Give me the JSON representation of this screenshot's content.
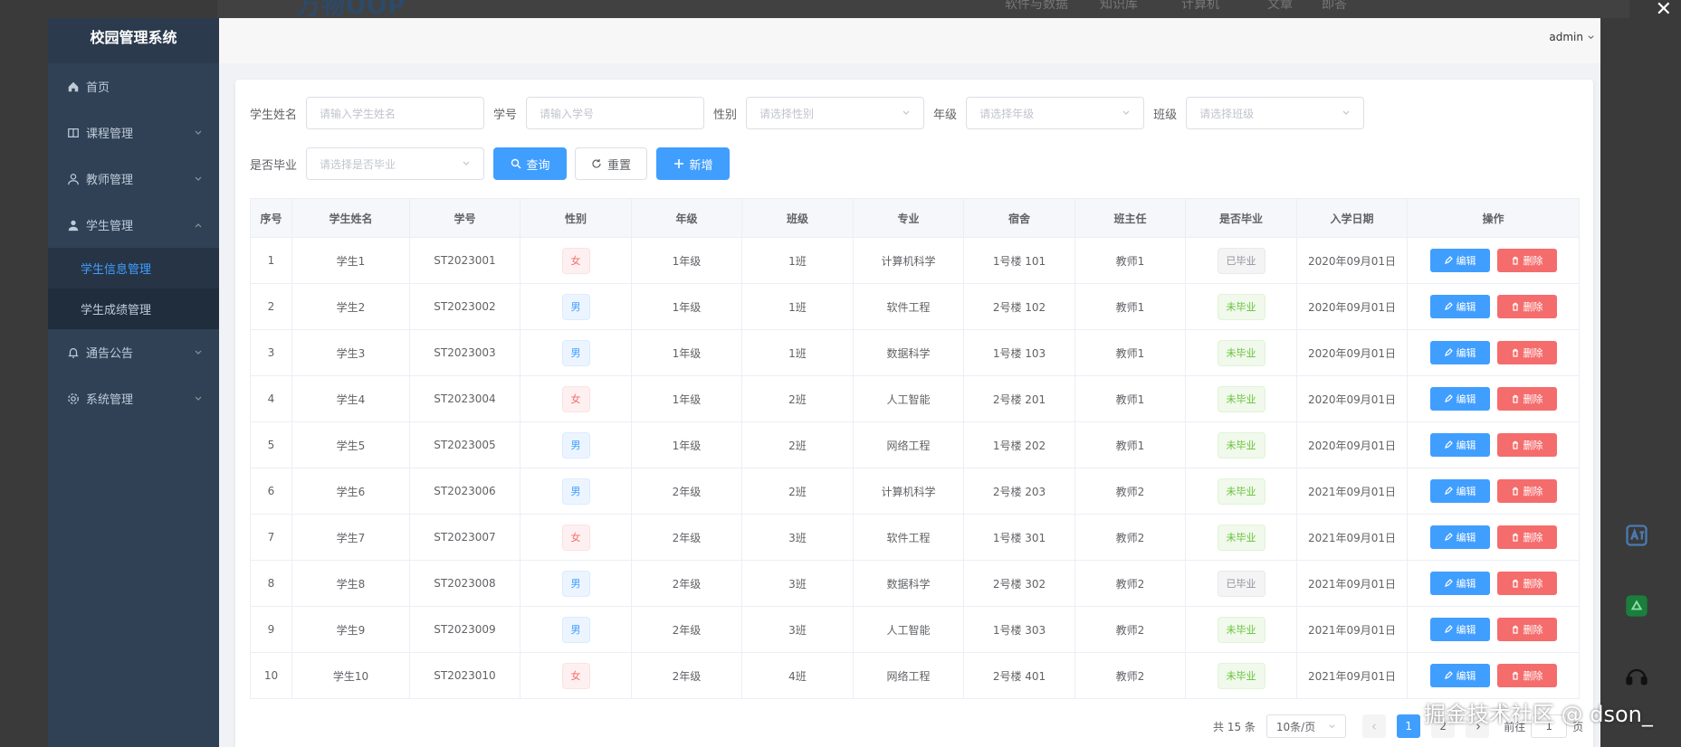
{
  "host": {
    "logo": "万物OOP",
    "nav": [
      "软件与数据",
      "知识库",
      "计算机",
      "文章",
      "即答"
    ]
  },
  "overlay": {
    "close_label": "✕"
  },
  "app": {
    "title": "校园管理系统",
    "user": "admin"
  },
  "sidebar": {
    "items": [
      {
        "label": "首页",
        "icon": "home-icon"
      },
      {
        "label": "课程管理",
        "icon": "book-icon"
      },
      {
        "label": "教师管理",
        "icon": "user-icon"
      },
      {
        "label": "学生管理",
        "icon": "user-icon"
      },
      {
        "label": "学生信息管理"
      },
      {
        "label": "学生成绩管理"
      },
      {
        "label": "通告公告",
        "icon": "bell-icon"
      },
      {
        "label": "系统管理",
        "icon": "gear-icon"
      }
    ]
  },
  "search": {
    "name_label": "学生姓名",
    "name_placeholder": "请输入学生姓名",
    "no_label": "学号",
    "no_placeholder": "请输入学号",
    "gender_label": "性别",
    "gender_placeholder": "请选择性别",
    "grade_label": "年级",
    "grade_placeholder": "请选择年级",
    "class_label": "班级",
    "class_placeholder": "请选择班级",
    "grad_label": "是否毕业",
    "grad_placeholder": "请选择是否毕业",
    "query_label": "查询",
    "reset_label": "重置",
    "add_label": "新增"
  },
  "table": {
    "headers": [
      "序号",
      "学生姓名",
      "学号",
      "性别",
      "年级",
      "班级",
      "专业",
      "宿舍",
      "班主任",
      "是否毕业",
      "入学日期",
      "操作"
    ],
    "edit_label": "编辑",
    "delete_label": "删除",
    "rows": [
      {
        "idx": "1",
        "name": "学生1",
        "no": "ST2023001",
        "gender": "女",
        "grade": "1年级",
        "cls": "1班",
        "major": "计算机科学",
        "dorm": "1号楼 101",
        "teacher": "教师1",
        "status": "已毕业",
        "date": "2020年09月01日"
      },
      {
        "idx": "2",
        "name": "学生2",
        "no": "ST2023002",
        "gender": "男",
        "grade": "1年级",
        "cls": "1班",
        "major": "软件工程",
        "dorm": "2号楼 102",
        "teacher": "教师1",
        "status": "未毕业",
        "date": "2020年09月01日"
      },
      {
        "idx": "3",
        "name": "学生3",
        "no": "ST2023003",
        "gender": "男",
        "grade": "1年级",
        "cls": "1班",
        "major": "数据科学",
        "dorm": "1号楼 103",
        "teacher": "教师1",
        "status": "未毕业",
        "date": "2020年09月01日"
      },
      {
        "idx": "4",
        "name": "学生4",
        "no": "ST2023004",
        "gender": "女",
        "grade": "1年级",
        "cls": "2班",
        "major": "人工智能",
        "dorm": "2号楼 201",
        "teacher": "教师1",
        "status": "未毕业",
        "date": "2020年09月01日"
      },
      {
        "idx": "5",
        "name": "学生5",
        "no": "ST2023005",
        "gender": "男",
        "grade": "1年级",
        "cls": "2班",
        "major": "网络工程",
        "dorm": "1号楼 202",
        "teacher": "教师1",
        "status": "未毕业",
        "date": "2020年09月01日"
      },
      {
        "idx": "6",
        "name": "学生6",
        "no": "ST2023006",
        "gender": "男",
        "grade": "2年级",
        "cls": "2班",
        "major": "计算机科学",
        "dorm": "2号楼 203",
        "teacher": "教师2",
        "status": "未毕业",
        "date": "2021年09月01日"
      },
      {
        "idx": "7",
        "name": "学生7",
        "no": "ST2023007",
        "gender": "女",
        "grade": "2年级",
        "cls": "3班",
        "major": "软件工程",
        "dorm": "1号楼 301",
        "teacher": "教师2",
        "status": "未毕业",
        "date": "2021年09月01日"
      },
      {
        "idx": "8",
        "name": "学生8",
        "no": "ST2023008",
        "gender": "男",
        "grade": "2年级",
        "cls": "3班",
        "major": "数据科学",
        "dorm": "2号楼 302",
        "teacher": "教师2",
        "status": "已毕业",
        "date": "2021年09月01日"
      },
      {
        "idx": "9",
        "name": "学生9",
        "no": "ST2023009",
        "gender": "男",
        "grade": "2年级",
        "cls": "3班",
        "major": "人工智能",
        "dorm": "1号楼 303",
        "teacher": "教师2",
        "status": "未毕业",
        "date": "2021年09月01日"
      },
      {
        "idx": "10",
        "name": "学生10",
        "no": "ST2023010",
        "gender": "女",
        "grade": "2年级",
        "cls": "4班",
        "major": "网络工程",
        "dorm": "2号楼 401",
        "teacher": "教师2",
        "status": "未毕业",
        "date": "2021年09月01日"
      }
    ]
  },
  "pagination": {
    "total": "共 15 条",
    "page_size": "10条/页",
    "pages": [
      "1",
      "2"
    ],
    "jump_label": "前往",
    "jump_value": "1",
    "page_suffix": "页"
  },
  "watermark": "掘金技术社区 @ dson_",
  "colors": {
    "primary": "#409eff",
    "danger": "#f56c6c",
    "success": "#67c23a",
    "sidebar_bg": "#304156"
  }
}
